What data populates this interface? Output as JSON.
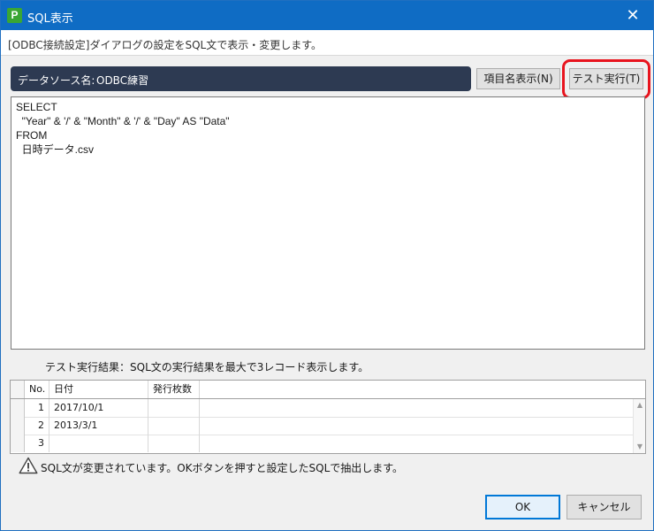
{
  "window": {
    "title": "SQL表示",
    "app_icon": "P",
    "close_glyph": "✕"
  },
  "description": "[ODBC接続設定]ダイアログの設定をSQL文で表示・変更します。",
  "datasource": {
    "label": "データソース名:",
    "value": "ODBC練習"
  },
  "buttons": {
    "fields": "項目名表示(N)",
    "test": "テスト実行(T)",
    "ok": "OK",
    "cancel": "キャンセル"
  },
  "sql_lines": [
    "SELECT",
    "  \"Year\" & '/' & \"Month\" & '/' & \"Day\" AS \"Data\"",
    "FROM",
    "  日時データ.csv"
  ],
  "result_caption": "テスト実行結果：SQL文の実行結果を最大で3レコード表示します。",
  "grid": {
    "headers": {
      "no": "No.",
      "date": "日付",
      "count": "発行枚数"
    },
    "rows": [
      {
        "no": "1",
        "date": "2017/10/1",
        "count": ""
      },
      {
        "no": "2",
        "date": "2013/3/1",
        "count": ""
      },
      {
        "no": "3",
        "date": "",
        "count": ""
      }
    ]
  },
  "warning": {
    "text": "SQL文が変更されています。OKボタンを押すと設定したSQLで抽出します。",
    "icon": "warning-triangle-icon"
  },
  "colors": {
    "titlebar": "#0f6cc4",
    "datasource_bar": "#2d3a52",
    "highlight": "#e8141e",
    "app_icon": "#3aa635"
  }
}
